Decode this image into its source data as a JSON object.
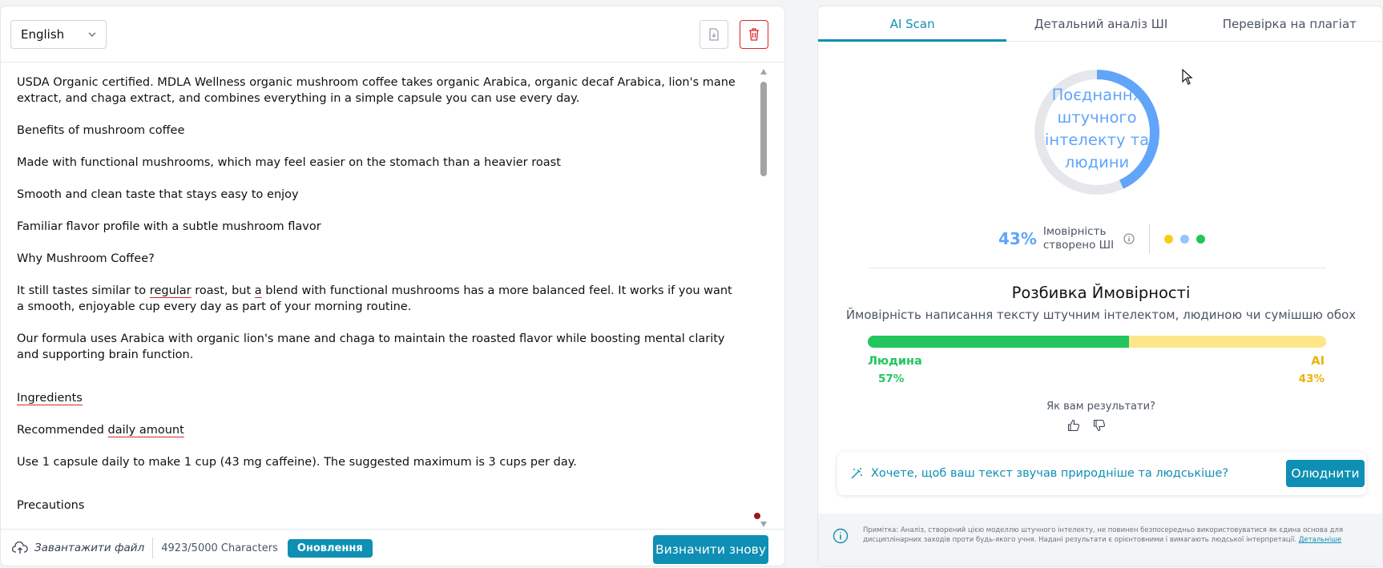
{
  "editor": {
    "language": "English",
    "paragraphs": [
      "USDA Organic certified. MDLA Wellness organic mushroom coffee takes organic Arabica, organic decaf Arabica, lion's mane extract, and chaga extract, and combines everything in a simple capsule you can use every day.",
      "Benefits of mushroom coffee",
      "Made with functional mushrooms, which may feel easier on the stomach than a heavier roast",
      "Smooth and clean taste that stays easy to enjoy",
      "Familiar flavor profile with a subtle mushroom flavor",
      "Why Mushroom Coffee?"
    ],
    "p7_a": "It still tastes similar to ",
    "p7_b": "regular",
    "p7_c": " roast, but ",
    "p7_d": "a",
    "p7_e": " blend with functional mushrooms has a more balanced feel. It works if you want a smooth, enjoyable cup every day as part of your morning routine.",
    "p8": "Our formula uses Arabica with organic lion's mane and chaga to maintain the roasted flavor while boosting mental clarity and supporting brain function.",
    "p9": "Ingredients",
    "p10_a": "Recommended ",
    "p10_b": "daily amount",
    "p11": "Use 1 capsule daily to make 1 cup (43 mg caffeine). The suggested maximum is 3 cups per day.",
    "p12": "Precautions"
  },
  "footer": {
    "upload_label": "Завантажити файл",
    "char_count": "4923/5000 Characters",
    "update_label": "Оновлення",
    "recheck_label": "Визначити знову"
  },
  "results": {
    "tabs": [
      "AI Scan",
      "Детальний аналіз ШІ",
      "Перевірка на плагіат"
    ],
    "donut_label": "Поєднання штучного інтелекту та людини",
    "ai_percent_text": "43%",
    "ai_probability_label_1": "Імовірність",
    "ai_probability_label_2": "створено ШІ",
    "breakdown_title": "Розбивка Ймовірності",
    "breakdown_subtitle": "Ймовірність написання тексту штучним інтелектом, людиною чи сумішшю обох",
    "human_label": "Людина",
    "human_pct_text": "57%",
    "ai_label": "AI",
    "ai_pct_text": "43%",
    "human_fraction": 0.57,
    "ai_fraction": 0.43,
    "question": "Як вам результати?",
    "humanize_prompt": "Хочете, щоб ваш текст звучав природніше та людськіше?",
    "humanize_button": "Олюднити",
    "note": "Примітка: Аналіз, створений цією моделлю штучного інтелекту, не повинен безпосередньо використовуватися як єдина основа для дисциплінарних заходів проти будь-якого учня. Надані результати є орієнтовними і вимагають людської інтерпретації.",
    "note_link": "Детальніше"
  },
  "colors": {
    "accent": "#0e8fb3",
    "human": "#22c55e",
    "ai": "#fde68a",
    "ai_text": "#eab308",
    "donut_fill": "#60a5fa",
    "donut_track": "#e5e7eb",
    "dot_yellow": "#facc15",
    "dot_blue": "#93c5fd",
    "dot_green": "#22c55e"
  }
}
